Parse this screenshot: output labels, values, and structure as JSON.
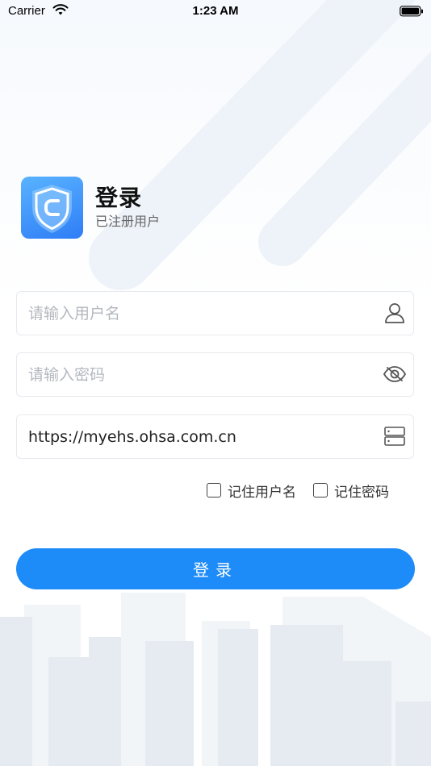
{
  "status_bar": {
    "carrier": "Carrier",
    "time": "1:23 AM"
  },
  "header": {
    "title": "登录",
    "subtitle": "已注册用户"
  },
  "form": {
    "username": {
      "placeholder": "请输入用户名",
      "value": ""
    },
    "password": {
      "placeholder": "请输入密码",
      "value": ""
    },
    "server": {
      "value": "https://myehs.ohsa.com.cn"
    },
    "remember_username_label": "记住用户名",
    "remember_password_label": "记住密码",
    "remember_username_checked": false,
    "remember_password_checked": false
  },
  "login_button": {
    "label": "登录"
  },
  "icons": {
    "logo": "shield-icon",
    "username": "user-icon",
    "password": "eye-off-icon",
    "server": "server-icon",
    "wifi": "wifi-icon",
    "battery": "battery-icon"
  },
  "colors": {
    "accent": "#1d8bf8",
    "logo_gradient_start": "#59b3ff",
    "logo_gradient_end": "#2f7df6"
  }
}
